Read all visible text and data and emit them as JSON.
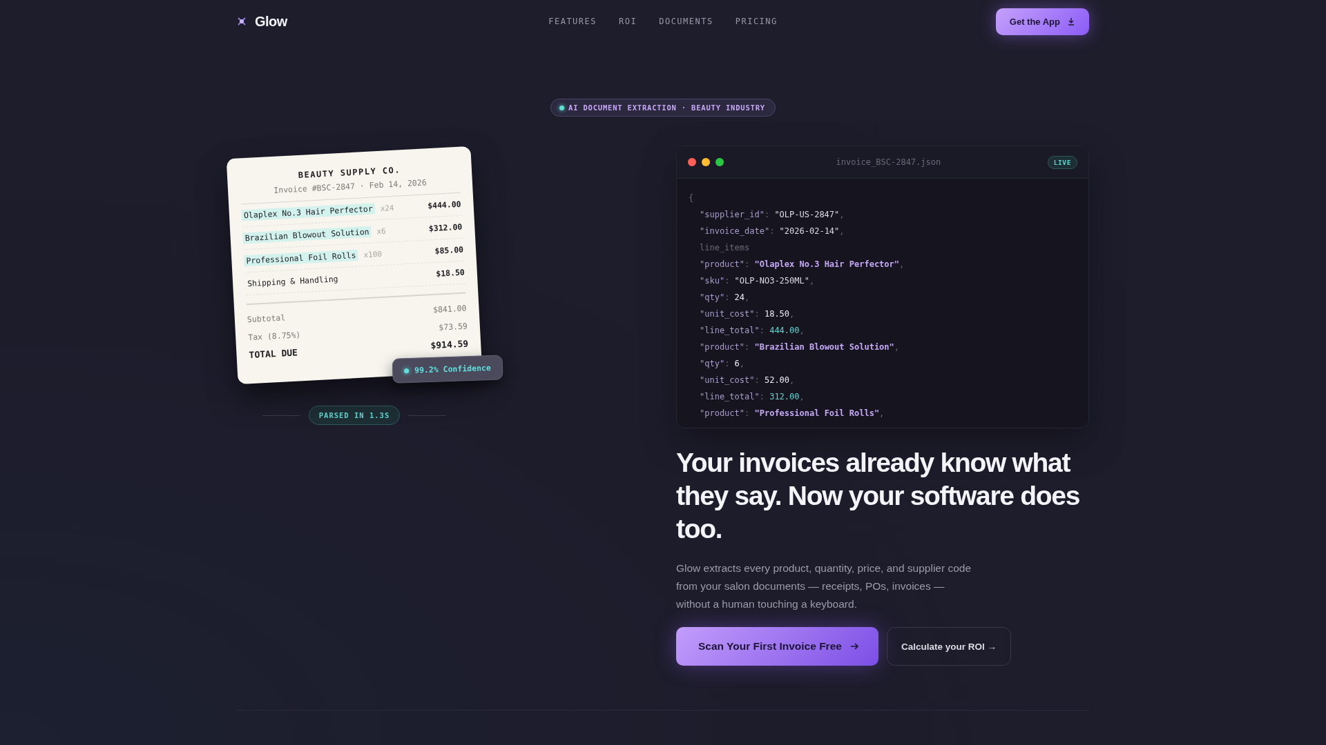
{
  "nav": {
    "brand": "Glow",
    "links": [
      "FEATURES",
      "ROI",
      "DOCUMENTS",
      "PRICING"
    ],
    "cta": "Get the App"
  },
  "eyebrow": "AI DOCUMENT EXTRACTION · BEAUTY INDUSTRY",
  "receipt": {
    "company": "BEAUTY SUPPLY CO.",
    "meta": "Invoice #BSC-2847 · Feb 14, 2026",
    "items": [
      {
        "name": "Olaplex No.3 Hair Perfector",
        "qty": "x24",
        "price": "$444.00",
        "highlighted": true
      },
      {
        "name": "Brazilian Blowout Solution",
        "qty": "x6",
        "price": "$312.00",
        "highlighted": true
      },
      {
        "name": "Professional Foil Rolls",
        "qty": "x100",
        "price": "$85.00",
        "highlighted": true
      },
      {
        "name": "Shipping & Handling",
        "price": "$18.50",
        "highlighted": false
      }
    ],
    "totals": [
      {
        "label": "Subtotal",
        "value": "$841.00",
        "kind": "normal"
      },
      {
        "label": "Tax (8.75%)",
        "value": "$73.59",
        "kind": "normal"
      },
      {
        "label": "TOTAL DUE",
        "value": "$914.59",
        "kind": "grand"
      }
    ],
    "confidence": "99.2% Confidence"
  },
  "parsed": "PARSED IN 1.3S",
  "code": {
    "filename": "invoice_BSC-2847.json",
    "badge": "LIVE",
    "lines": [
      {
        "kind": "punct",
        "text": "{"
      },
      {
        "kind": "pair",
        "key": "\"supplier_id\"",
        "sep": ": ",
        "value": {
          "kind": "string",
          "text": "\"OLP-US-2847\""
        },
        "end": ","
      },
      {
        "kind": "pair",
        "key": "\"invoice_date\"",
        "sep": ": ",
        "value": {
          "kind": "string",
          "text": "\"2026-02-14\""
        },
        "end": ","
      },
      {
        "kind": "label",
        "text": "line_items"
      },
      {
        "kind": "pair",
        "key": "\"product\"",
        "sep": ": ",
        "value": {
          "kind": "product",
          "text": "\"Olaplex No.3 Hair Perfector\""
        },
        "end": ","
      },
      {
        "kind": "pair",
        "key": "\"sku\"",
        "sep": ": ",
        "value": {
          "kind": "string",
          "text": "\"OLP-NO3-250ML\""
        },
        "end": ","
      },
      {
        "kind": "pair",
        "key": "\"qty\"",
        "sep": ": ",
        "value": {
          "kind": "number",
          "text": "24"
        },
        "end": ","
      },
      {
        "kind": "pair",
        "key": "\"unit_cost\"",
        "sep": ": ",
        "value": {
          "kind": "number",
          "text": "18.50"
        },
        "end": ","
      },
      {
        "kind": "pair",
        "key": "\"line_total\"",
        "sep": ": ",
        "value": {
          "kind": "total",
          "text": "444.00"
        },
        "end": ","
      },
      {
        "kind": "pair",
        "key": "\"product\"",
        "sep": ": ",
        "value": {
          "kind": "product",
          "text": "\"Brazilian Blowout Solution\""
        },
        "end": ","
      },
      {
        "kind": "pair",
        "key": "\"qty\"",
        "sep": ": ",
        "value": {
          "kind": "number",
          "text": "6"
        },
        "end": ","
      },
      {
        "kind": "pair",
        "key": "\"unit_cost\"",
        "sep": ": ",
        "value": {
          "kind": "number",
          "text": "52.00"
        },
        "end": ","
      },
      {
        "kind": "pair",
        "key": "\"line_total\"",
        "sep": ": ",
        "value": {
          "kind": "total",
          "text": "312.00"
        },
        "end": ","
      },
      {
        "kind": "pair",
        "key": "\"product\"",
        "sep": ": ",
        "value": {
          "kind": "product",
          "text": "\"Professional Foil Rolls\""
        },
        "end": ","
      }
    ]
  },
  "hero": {
    "heading": "Your invoices already know what they say. Now your software does too.",
    "body": "Glow extracts every product, quantity, price, and supplier code from your salon documents — receipts, POs, invoices — without a human touching a keyboard.",
    "primary": "Scan Your First Invoice Free",
    "secondary": "Calculate your ROI →"
  }
}
